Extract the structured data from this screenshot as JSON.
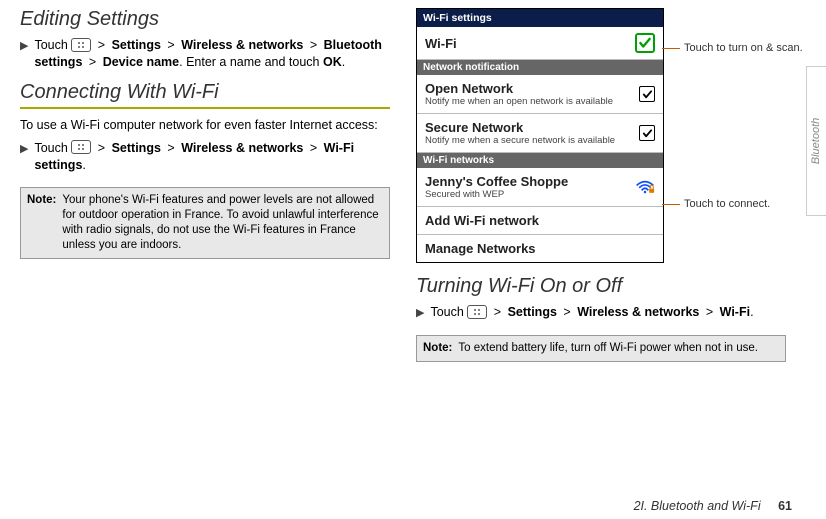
{
  "left": {
    "heading1": "Editing Settings",
    "step1_pre": "Touch",
    "step1_settings": "Settings",
    "step1_wireless": "Wireless & networks",
    "step1_bt": "Bluetooth settings",
    "step1_device": "Device name",
    "step1_after": ". Enter a name and touch ",
    "step1_ok": "OK",
    "step1_period": ".",
    "heading2": "Connecting With Wi-Fi",
    "intro2": "To use a Wi-Fi computer network for even faster Internet access:",
    "step2_pre": "Touch",
    "step2_settings": "Settings",
    "step2_wireless": "Wireless & networks",
    "step2_wifiset": "Wi-Fi settings",
    "step2_period": ".",
    "note1_label": "Note:",
    "note1_text": "Your phone's Wi-Fi features and power levels are not allowed for outdoor operation in France. To avoid unlawful interference with radio signals, do not use the Wi-Fi features in France unless you are indoors."
  },
  "phone": {
    "titlebar": "Wi-Fi settings",
    "row_wifi": "Wi-Fi",
    "section_notif": "Network notification",
    "row_open_title": "Open Network",
    "row_open_sub": "Notify me when an open network is available",
    "row_secure_title": "Secure Network",
    "row_secure_sub": "Notify me when a secure network is available",
    "section_networks": "Wi-Fi networks",
    "row_jenny_title": "Jenny's Coffee Shoppe",
    "row_jenny_sub": "Secured with WEP",
    "row_add": "Add Wi-Fi network",
    "row_manage": "Manage Networks"
  },
  "annotations": {
    "a1": "Touch to turn on & scan.",
    "a2": "Touch to connect."
  },
  "right": {
    "heading3": "Turning Wi-Fi On or Off",
    "step3_pre": "Touch",
    "step3_settings": "Settings",
    "step3_wireless": "Wireless & networks",
    "step3_wifi": "Wi-Fi",
    "step3_period": ".",
    "note2_label": "Note:",
    "note2_text": "To extend battery life, turn off Wi-Fi power when not in use."
  },
  "footer": {
    "chapter": "2I. Bluetooth and Wi-Fi",
    "page": "61"
  },
  "sidetab": "Bluetooth",
  "glyph_gt": ">"
}
